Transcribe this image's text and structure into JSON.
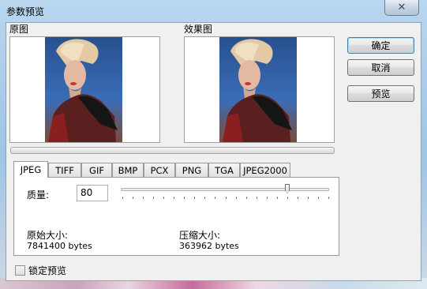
{
  "window": {
    "title": "参数预览",
    "close_glyph": "✕"
  },
  "preview": {
    "original_label": "原图",
    "effect_label": "效果图"
  },
  "buttons": {
    "ok": "确定",
    "cancel": "取消",
    "preview": "预览"
  },
  "tabs": [
    "JPEG",
    "TIFF",
    "GIF",
    "BMP",
    "PCX",
    "PNG",
    "TGA",
    "JPEG2000"
  ],
  "active_tab": "JPEG",
  "jpeg": {
    "quality_label": "质量:",
    "quality_value": "80",
    "quality_level": 0.8,
    "original_size_label": "原始大小:",
    "original_size_value": "7841400 bytes",
    "compressed_size_label": "压缩大小:",
    "compressed_size_value": "363962 bytes"
  },
  "lock_preview": {
    "label": "锁定预览",
    "checked": false
  }
}
